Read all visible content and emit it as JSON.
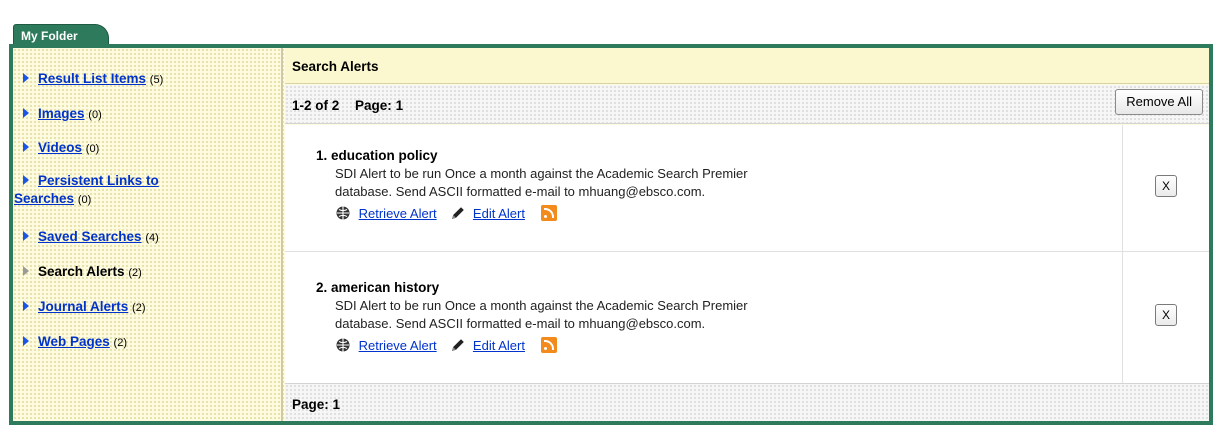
{
  "tab": {
    "label": "My Folder"
  },
  "sidebar": {
    "items": [
      {
        "label": "Result List Items",
        "count": "(5)",
        "link": true
      },
      {
        "label": "Images",
        "count": "(0)",
        "link": true
      },
      {
        "label": "Videos",
        "count": "(0)",
        "link": true
      },
      {
        "label_line1": "Persistent Links to",
        "label_line2": "Searches",
        "count": "(0)",
        "link": true
      },
      {
        "label": "Saved Searches",
        "count": "(4)",
        "link": true
      },
      {
        "label": "Search Alerts",
        "count": "(2)",
        "link": false
      },
      {
        "label": "Journal Alerts",
        "count": "(2)",
        "link": true
      },
      {
        "label": "Web Pages",
        "count": "(2)",
        "link": true
      }
    ]
  },
  "section": {
    "title": "Search Alerts"
  },
  "pager_top": {
    "range": "1-2 of 2",
    "page_label": "Page:",
    "page": "1",
    "remove_all": "Remove All"
  },
  "alerts": [
    {
      "number": "1.",
      "title": "education policy",
      "desc_line1": "SDI Alert to be run Once a month against the Academic Search Premier",
      "desc_line2": "database. Send ASCII formatted e-mail to mhuang@ebsco.com.",
      "retrieve": "Retrieve Alert",
      "edit": "Edit Alert",
      "delete": "X"
    },
    {
      "number": "2.",
      "title": "american history",
      "desc_line1": "SDI Alert to be run Once a month against the Academic Search Premier",
      "desc_line2": "database. Send ASCII formatted e-mail to mhuang@ebsco.com.",
      "retrieve": "Retrieve Alert",
      "edit": "Edit Alert",
      "delete": "X"
    }
  ],
  "pager_bottom": {
    "page_label": "Page:",
    "page": "1"
  },
  "icons": {
    "item_arrow": "triangle-right-icon",
    "retrieve": "globe-icon",
    "edit": "pencil-icon",
    "rss": "rss-icon"
  },
  "colors": {
    "frame": "#2e7a5c",
    "link": "#0033cc",
    "rss": "#f28a1c",
    "panel_bg": "#fdfbe0"
  }
}
